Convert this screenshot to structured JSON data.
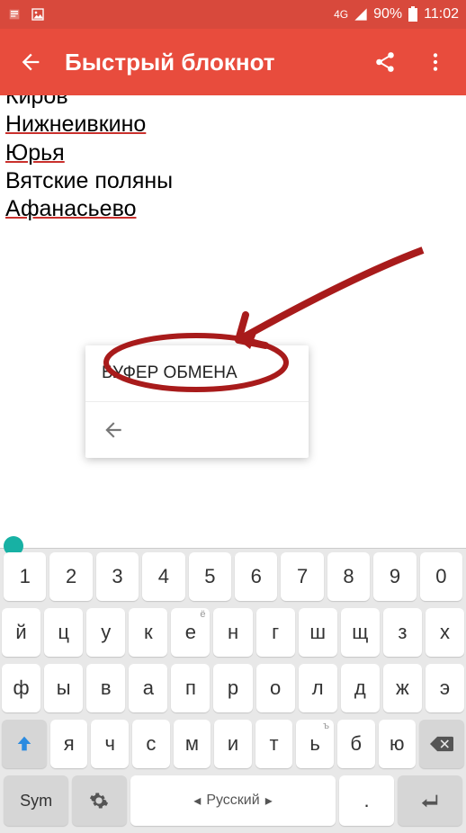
{
  "status": {
    "network": "4G",
    "battery": "90%",
    "time": "11:02"
  },
  "appbar": {
    "title": "Быстрый блокнот"
  },
  "note": {
    "lines": [
      "Киров",
      "Нижнеивкино",
      "Юрья",
      "Вятские поляны",
      "Афанасьево"
    ]
  },
  "tooltip": {
    "label": "БУФЕР ОБМЕНА"
  },
  "keyboard": {
    "digits": [
      "1",
      "2",
      "3",
      "4",
      "5",
      "6",
      "7",
      "8",
      "9",
      "0"
    ],
    "row1": [
      "й",
      "ц",
      "у",
      "к",
      "е",
      "н",
      "г",
      "ш",
      "щ",
      "з",
      "х"
    ],
    "row1hints": [
      "",
      "",
      "",
      "",
      "ё",
      "",
      "",
      "",
      "",
      "",
      ""
    ],
    "row2": [
      "ф",
      "ы",
      "в",
      "а",
      "п",
      "р",
      "о",
      "л",
      "д",
      "ж",
      "э"
    ],
    "row3": [
      "я",
      "ч",
      "с",
      "м",
      "и",
      "т",
      "ь",
      "б",
      "ю"
    ],
    "row3hints": [
      "",
      "",
      "",
      "",
      "",
      "",
      "ъ",
      "",
      ""
    ],
    "sym": "Sym",
    "lang": "Русский",
    "dot": "."
  }
}
